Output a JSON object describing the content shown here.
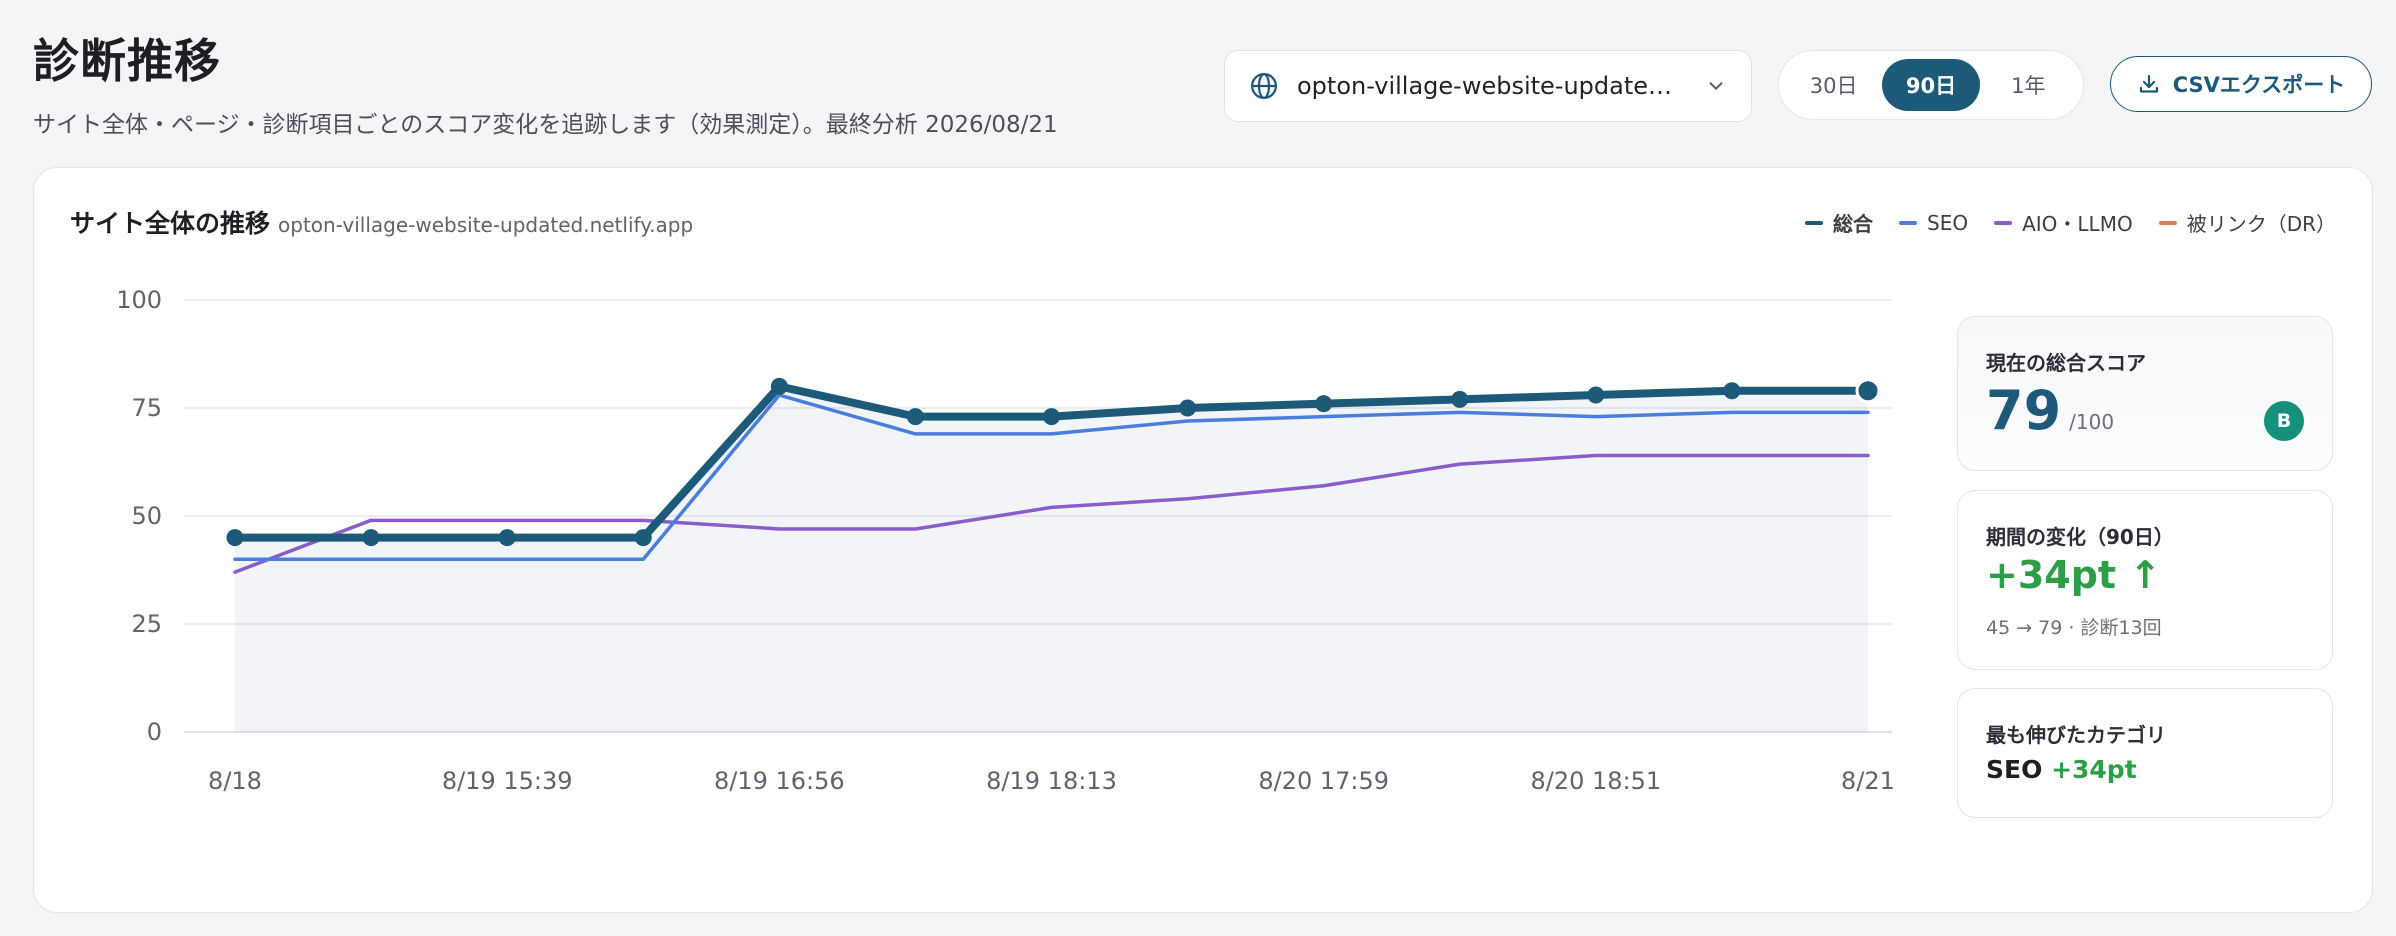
{
  "header": {
    "title": "診断推移",
    "subtitle": "サイト全体・ページ・診断項目ごとのスコア変化を追跡します（効果測定）。最終分析 2026/08/21"
  },
  "site_select": {
    "value": "opton-village-website-updated.netl..."
  },
  "range": {
    "items": [
      "30日",
      "90日",
      "1年"
    ],
    "active": "90日"
  },
  "csv_button": "CSVエクスポート",
  "card": {
    "title": "サイト全体の推移",
    "subtitle": "opton-village-website-updated.netlify.app"
  },
  "legend": {
    "total": "総合",
    "seo": "SEO",
    "aio": "AIO・LLMO",
    "backlink": "被リンク（DR）"
  },
  "colors": {
    "total": "#1d5a7a",
    "seo": "#4a7de0",
    "aio": "#8a5ccc",
    "backlink": "#e07a52",
    "positive": "#2e9e46"
  },
  "stats": {
    "current_label": "現在の総合スコア",
    "current_score": "79",
    "current_max": "/100",
    "grade": "B",
    "change_label": "期間の変化（90日）",
    "change_value": "+34pt ↑",
    "change_detail": "45 → 79 · 診断13回",
    "best_label": "最も伸びたカテゴリ",
    "best_category": "SEO",
    "best_gain": "+34pt"
  },
  "chart_data": {
    "type": "line",
    "title": "サイト全体の推移",
    "ylim": [
      0,
      100
    ],
    "yticks": [
      0,
      25,
      50,
      75,
      100
    ],
    "xtick_labels": [
      "8/18",
      "8/19 15:39",
      "8/19 16:56",
      "8/19 18:13",
      "8/20 17:59",
      "8/20 18:51",
      "8/21"
    ],
    "grid": true,
    "legend_position": "top-right",
    "series": [
      {
        "name": "総合",
        "key": "total",
        "values": [
          45,
          45,
          45,
          45,
          80,
          73,
          73,
          75,
          76,
          77,
          78,
          79,
          79
        ]
      },
      {
        "name": "SEO",
        "key": "seo",
        "values": [
          40,
          40,
          40,
          40,
          78,
          69,
          69,
          72,
          73,
          74,
          73,
          74,
          74
        ]
      },
      {
        "name": "AIO・LLMO",
        "key": "aio",
        "values": [
          37,
          49,
          49,
          49,
          47,
          47,
          52,
          54,
          57,
          62,
          64,
          64,
          64
        ]
      }
    ]
  }
}
